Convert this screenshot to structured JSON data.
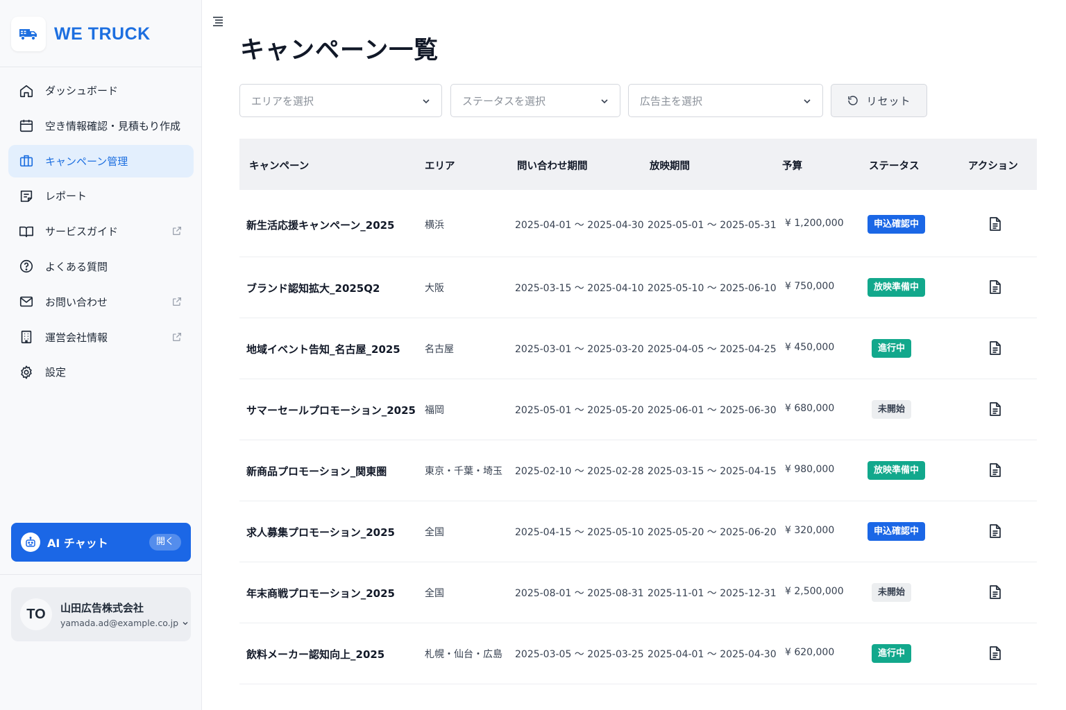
{
  "brand": {
    "name": "WE TRUCK",
    "logo_icon": "truck-icon",
    "accent": "#1d6fe0"
  },
  "sidebar": {
    "items": [
      {
        "label": "ダッシュボード",
        "icon": "home-icon",
        "active": false,
        "external": false
      },
      {
        "label": "空き情報確認・見積もり作成",
        "icon": "calendar-icon",
        "active": false,
        "external": false
      },
      {
        "label": "キャンペーン管理",
        "icon": "briefcase-icon",
        "active": true,
        "external": false
      },
      {
        "label": "レポート",
        "icon": "report-icon",
        "active": false,
        "external": false
      },
      {
        "label": "サービスガイド",
        "icon": "book-icon",
        "active": false,
        "external": true
      },
      {
        "label": "よくある質問",
        "icon": "question-icon",
        "active": false,
        "external": false
      },
      {
        "label": "お問い合わせ",
        "icon": "mail-icon",
        "active": false,
        "external": true
      },
      {
        "label": "運営会社情報",
        "icon": "building-icon",
        "active": false,
        "external": true
      },
      {
        "label": "設定",
        "icon": "gear-icon",
        "active": false,
        "external": false
      }
    ],
    "ai_chat": {
      "label": "AI チャット",
      "open_label": "開く",
      "icon": "robot-icon"
    },
    "user": {
      "initials": "TO",
      "name": "山田広告株式会社",
      "email": "yamada.ad@example.co.jp"
    }
  },
  "main": {
    "title": "キャンペーン一覧",
    "filters": {
      "area_placeholder": "エリアを選択",
      "status_placeholder": "ステータスを選択",
      "advertiser_placeholder": "広告主を選択",
      "reset_label": "リセット"
    },
    "table": {
      "headers": [
        "キャンペーン",
        "エリア",
        "問い合わせ期間",
        "放映期間",
        "予算",
        "ステータス",
        "アクション"
      ],
      "rows": [
        {
          "name": "新生活応援キャンペーン_2025",
          "area": "横浜",
          "inquiry": "2025-04-01 〜 2025-04-30",
          "broadcast": "2025-05-01 〜 2025-05-31",
          "budget": "¥ 1,200,000",
          "status": "申込確認中",
          "status_type": "blue"
        },
        {
          "name": "ブランド認知拡大_2025Q2",
          "area": "大阪",
          "inquiry": "2025-03-15 〜 2025-04-10",
          "broadcast": "2025-05-10 〜 2025-06-10",
          "budget": "¥ 750,000",
          "status": "放映準備中",
          "status_type": "teal"
        },
        {
          "name": "地域イベント告知_名古屋_2025",
          "area": "名古屋",
          "inquiry": "2025-03-01 〜 2025-03-20",
          "broadcast": "2025-04-05 〜 2025-04-25",
          "budget": "¥ 450,000",
          "status": "進行中",
          "status_type": "teal"
        },
        {
          "name": "サマーセールプロモーション_2025",
          "area": "福岡",
          "inquiry": "2025-05-01 〜 2025-05-20",
          "broadcast": "2025-06-01 〜 2025-06-30",
          "budget": "¥ 680,000",
          "status": "未開始",
          "status_type": "gray"
        },
        {
          "name": "新商品プロモーション_関東圏",
          "area": "東京・千葉・埼玉",
          "inquiry": "2025-02-10 〜 2025-02-28",
          "broadcast": "2025-03-15 〜 2025-04-15",
          "budget": "¥ 980,000",
          "status": "放映準備中",
          "status_type": "teal"
        },
        {
          "name": "求人募集プロモーション_2025",
          "area": "全国",
          "inquiry": "2025-04-15 〜 2025-05-10",
          "broadcast": "2025-05-20 〜 2025-06-20",
          "budget": "¥ 320,000",
          "status": "申込確認中",
          "status_type": "blue"
        },
        {
          "name": "年末商戦プロモーション_2025",
          "area": "全国",
          "inquiry": "2025-08-01 〜 2025-08-31",
          "broadcast": "2025-11-01 〜 2025-12-31",
          "budget": "¥ 2,500,000",
          "status": "未開始",
          "status_type": "gray"
        },
        {
          "name": "飲料メーカー認知向上_2025",
          "area": "札幌・仙台・広島",
          "inquiry": "2025-03-05 〜 2025-03-25",
          "broadcast": "2025-04-01 〜 2025-04-30",
          "budget": "¥ 620,000",
          "status": "進行中",
          "status_type": "teal"
        }
      ]
    }
  }
}
